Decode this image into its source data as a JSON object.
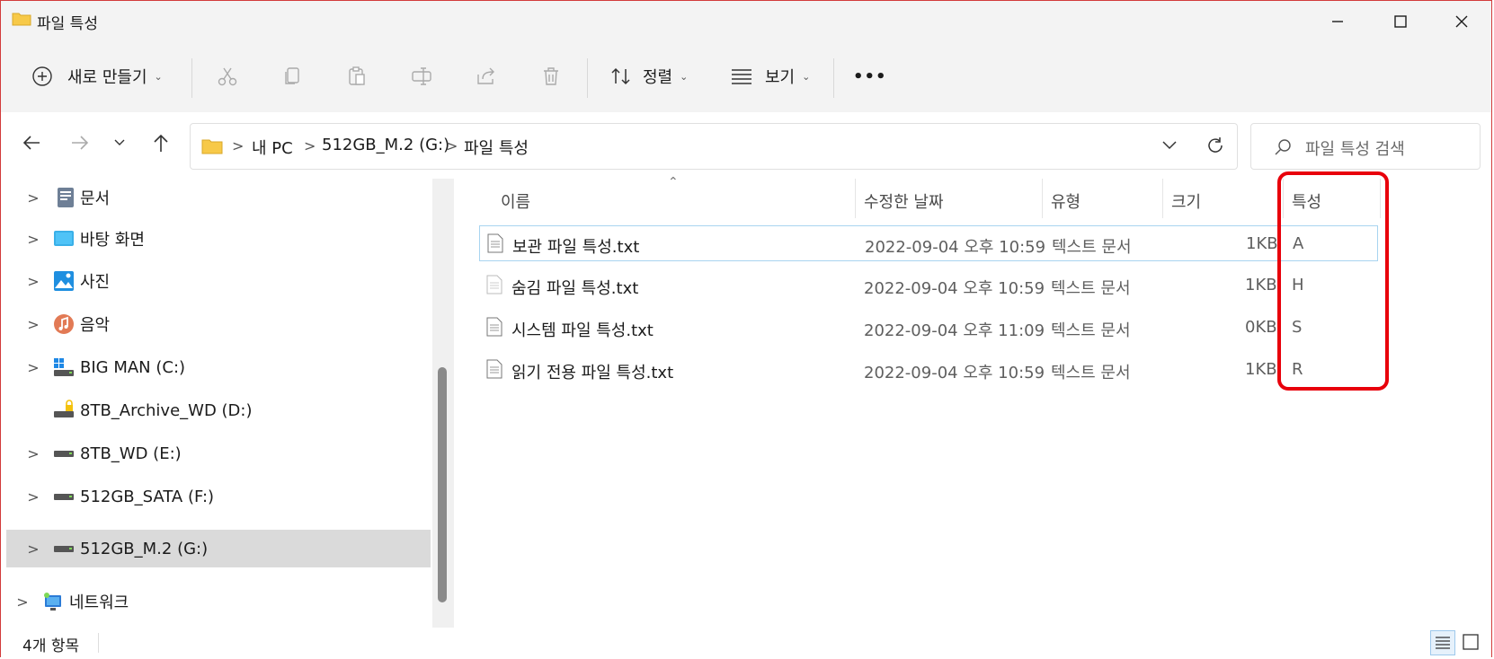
{
  "window": {
    "title": "파일 특성"
  },
  "toolbar": {
    "new_label": "새로 만들기",
    "sort_label": "정렬",
    "view_label": "보기",
    "more_label": "•••"
  },
  "address": {
    "segments": [
      "내 PC",
      "512GB_M.2 (G:)",
      "파일 특성"
    ]
  },
  "search": {
    "placeholder": "파일 특성 검색"
  },
  "sidebar": {
    "items": [
      {
        "label": "문서",
        "icon": "documents-icon"
      },
      {
        "label": "바탕 화면",
        "icon": "desktop-icon"
      },
      {
        "label": "사진",
        "icon": "pictures-icon"
      },
      {
        "label": "음악",
        "icon": "music-icon"
      },
      {
        "label": "BIG MAN (C:)",
        "icon": "system-drive-icon"
      },
      {
        "label": "8TB_Archive_WD (D:)",
        "icon": "locked-drive-icon"
      },
      {
        "label": "8TB_WD (E:)",
        "icon": "drive-icon"
      },
      {
        "label": "512GB_SATA (F:)",
        "icon": "drive-icon"
      },
      {
        "label": "512GB_M.2 (G:)",
        "icon": "drive-icon",
        "selected": true
      },
      {
        "label": "네트워크",
        "icon": "network-icon"
      }
    ]
  },
  "columns": {
    "name": "이름",
    "modified": "수정한 날짜",
    "type": "유형",
    "size": "크기",
    "attributes": "특성"
  },
  "files": [
    {
      "name": "보관 파일 특성.txt",
      "modified": "2022-09-04 오후 10:59",
      "type": "텍스트 문서",
      "size": "1KB",
      "attr": "A"
    },
    {
      "name": "숨김 파일 특성.txt",
      "modified": "2022-09-04 오후 10:59",
      "type": "텍스트 문서",
      "size": "1KB",
      "attr": "H"
    },
    {
      "name": "시스템 파일 특성.txt",
      "modified": "2022-09-04 오후 11:09",
      "type": "텍스트 문서",
      "size": "0KB",
      "attr": "S"
    },
    {
      "name": "읽기 전용 파일 특성.txt",
      "modified": "2022-09-04 오후 10:59",
      "type": "텍스트 문서",
      "size": "1KB",
      "attr": "R"
    }
  ],
  "status": {
    "item_count": "4개 항목"
  },
  "colors": {
    "highlight": "#e8000b",
    "selection": "#dadada",
    "folder": "#f7c948"
  }
}
